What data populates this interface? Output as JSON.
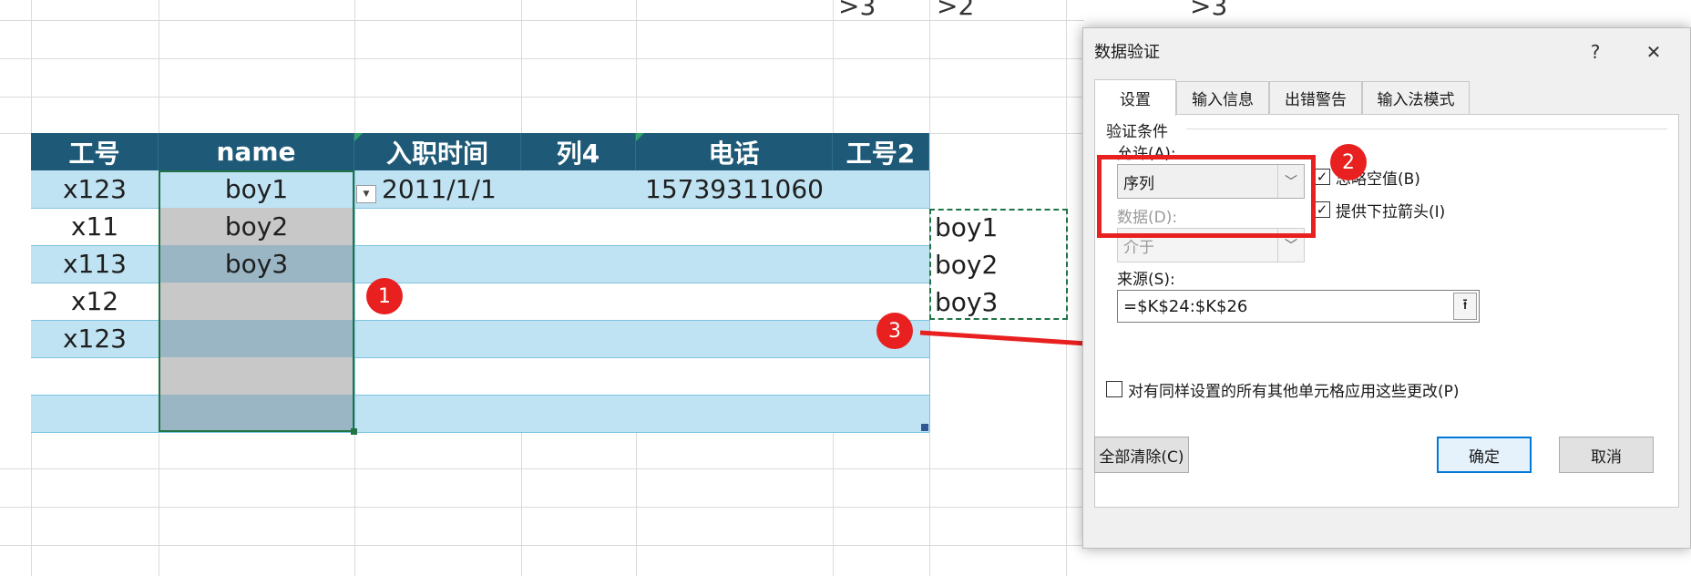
{
  "sheet": {
    "top_labels": [
      ">3",
      ">2",
      ">3"
    ],
    "headers": [
      "工号",
      "name",
      "入职时间",
      "列4",
      "电话",
      "工号2"
    ],
    "rows": [
      [
        "x123",
        "boy1",
        "2011/1/1",
        "",
        "15739311060",
        ""
      ],
      [
        "x11",
        "boy2",
        "",
        "",
        "",
        ""
      ],
      [
        "x113",
        "boy3",
        "",
        "",
        "",
        ""
      ],
      [
        "x12",
        "",
        "",
        "",
        "",
        ""
      ],
      [
        "x123",
        "",
        "",
        "",
        "",
        ""
      ],
      [
        "",
        "",
        "",
        "",
        "",
        ""
      ],
      [
        "",
        "",
        "",
        "",
        "",
        ""
      ]
    ],
    "source_list": [
      "boy1",
      "boy2",
      "boy3"
    ],
    "dropdown_icon": "dropdown-arrow-icon"
  },
  "annotations": [
    "1",
    "2",
    "3"
  ],
  "dialog": {
    "title": "数据验证",
    "help_label": "?",
    "close_label": "✕",
    "tabs": [
      "设置",
      "输入信息",
      "出错警告",
      "输入法模式"
    ],
    "group_label": "验证条件",
    "allow_label": "允许(A):",
    "allow_value": "序列",
    "ignore_blank_label": "忽略空值(B)",
    "ignore_blank_checked": true,
    "dropdown_label": "提供下拉箭头(I)",
    "dropdown_checked": true,
    "data_label": "数据(D):",
    "data_value": "介于",
    "source_label": "来源(S):",
    "source_value": "=$K$24:$K$26",
    "apply_all_label": "对有同样设置的所有其他单元格应用这些更改(P)",
    "apply_all_checked": false,
    "clear_all_label": "全部清除(C)",
    "ok_label": "确定",
    "cancel_label": "取消",
    "check_mark": "✓"
  },
  "colors": {
    "header_bg": "#1e5a78",
    "band_bg": "#bfe3f3",
    "selection_gray": "#c8c8c8",
    "annotation_red": "#e82020",
    "ok_border": "#0078d7"
  }
}
